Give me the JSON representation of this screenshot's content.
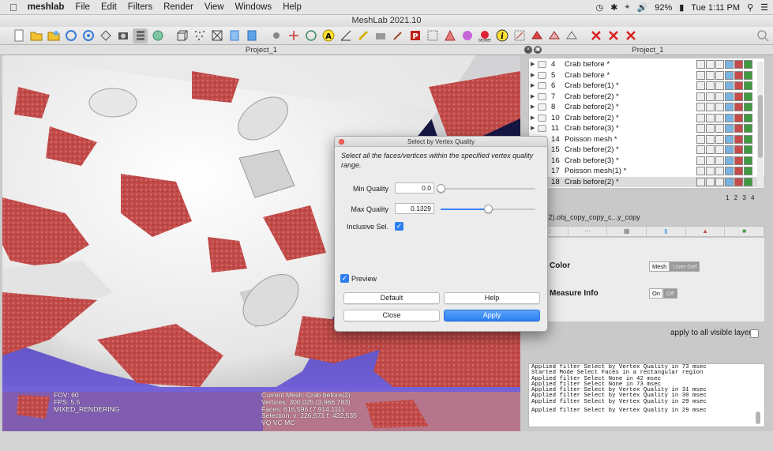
{
  "menubar": {
    "app_name": "meshlab",
    "menus": [
      "File",
      "Edit",
      "Filters",
      "Render",
      "View",
      "Windows",
      "Help"
    ],
    "battery": "92%",
    "clock": "Tue 1:11 PM"
  },
  "window": {
    "title": "MeshLab 2021.10"
  },
  "viewport": {
    "title": "Project_1",
    "overlay_left": [
      "FOV: 60",
      "FPS:    5.5",
      "MIXED_RENDERING"
    ],
    "overlay_right": [
      "Current Mesh: Crab before(2)",
      "Vertices: 300,025    (3,966,783)",
      "Faces: 616,596    (7,914,111)",
      "Selection: v: 226,571 f: 422,535",
      "VQ VC MC"
    ]
  },
  "sidebar": {
    "title": "Project_1",
    "layers": [
      {
        "num": "4",
        "name": "Crab before *",
        "selected": false
      },
      {
        "num": "5",
        "name": "Crab before *",
        "selected": false
      },
      {
        "num": "6",
        "name": "Crab before(1) *",
        "selected": false
      },
      {
        "num": "7",
        "name": "Crab before(2) *",
        "selected": false
      },
      {
        "num": "8",
        "name": "Crab before(2) *",
        "selected": false
      },
      {
        "num": "10",
        "name": "Crab before(2) *",
        "selected": false
      },
      {
        "num": "11",
        "name": "Crab before(3) *",
        "selected": false
      },
      {
        "num": "14",
        "name": "Poisson mesh *",
        "selected": false
      },
      {
        "num": "15",
        "name": "Crab before(2) *",
        "selected": false
      },
      {
        "num": "16",
        "name": "Crab before(3) *",
        "selected": false
      },
      {
        "num": "17",
        "name": "Poisson mesh(1) *",
        "selected": false
      },
      {
        "num": "18",
        "name": "Crab before(2) *",
        "selected": true
      }
    ],
    "pages_left": "3  4",
    "pages_right": "1  2  3  4",
    "mesh_filename": "efore(2).obj_copy_copy_c...y_copy",
    "props": {
      "color_label": "Color",
      "color_options": [
        "Mesh",
        "User-Def"
      ],
      "measure_label": "Measure Info",
      "measure_options": [
        "On",
        "Off"
      ]
    },
    "apply_all_label": "apply to all visible layers",
    "log": [
      "Applied filter Select by Vertex Quality in 73 msec",
      "Started Mode Select Faces in a rectangular region",
      "Applied filter Select None in 42 msec",
      "Applied filter Select None in 73 msec",
      "Applied filter Select by Vertex Quality in 31 msec",
      "Applied filter Select by Vertex Quality in 30 msec",
      "Applied filter Select by Vertex Quality in 29 msec",
      "",
      "Applied filter Select by Vertex Quality in 29 msec"
    ]
  },
  "dialog": {
    "title": "Select by Vertex Quality",
    "description": "Select all the faces/vertices within the specified vertex quality range.",
    "min_quality_label": "Min Quality",
    "min_quality_value": "0.0",
    "min_quality_slider": 0.0,
    "max_quality_label": "Max Quality",
    "max_quality_value": "0.1329",
    "max_quality_slider": 0.5,
    "inclusive_label": "Inclusive Sel.",
    "inclusive_checked": true,
    "preview_label": "Preview",
    "preview_checked": true,
    "buttons": {
      "default": "Default",
      "help": "Help",
      "close": "Close",
      "apply": "Apply"
    }
  },
  "colors": {
    "accent": "#2f7ff0",
    "mesh_selected": "#c0504d",
    "background_bottom": "#6f5fd8"
  }
}
